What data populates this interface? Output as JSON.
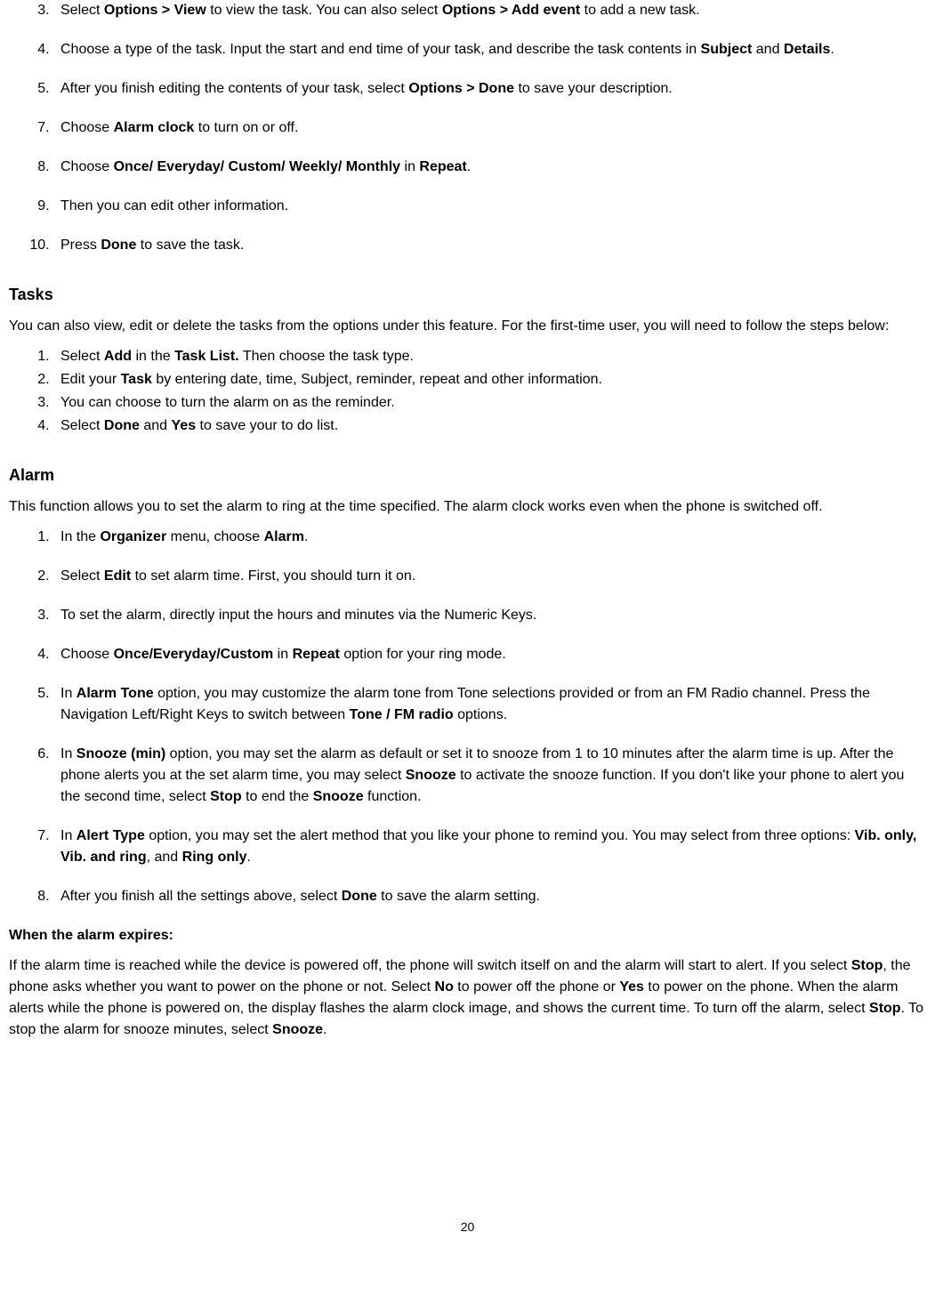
{
  "top_list": {
    "start": 3,
    "items": [
      "Select |Options > View| to view the task. You can also select |Options > Add event| to add a new task.",
      "Choose a type of the task. Input the start and end time of your task, and describe the task contents in |Subject| and |Details|.",
      "After you finish editing the contents of your task, select |Options > Done| to save your description.",
      "Choose |Alarm clock| to turn on or off.",
      "Choose |Once/ Everyday/ Custom/ Weekly/ Monthly| in |Repeat|.",
      "Then you can edit other information.",
      "Press |Done| to save the task."
    ],
    "custom_numbers": [
      3,
      4,
      5,
      7,
      8,
      9,
      10
    ]
  },
  "tasks": {
    "heading": "Tasks",
    "intro": "You can also view, edit or delete the tasks from the options under this feature. For the first-time user, you will need to follow the steps below:",
    "items": [
      "Select |Add| in the |Task List.| Then choose the task type.",
      "Edit your |Task| by entering date, time, Subject, reminder, repeat and other information.",
      "You can choose to turn the alarm on as the reminder.",
      "Select |Done| and |Yes| to save your to do list."
    ]
  },
  "alarm": {
    "heading": "Alarm",
    "intro": "This function allows you to set the alarm to ring at the time specified. The alarm clock works even when the phone is switched off.",
    "items": [
      "In the |Organizer| menu, choose |Alarm|.",
      "Select |Edit| to set alarm time. First, you should turn it on.",
      "To set the alarm, directly input the hours and minutes via the Numeric Keys.",
      "Choose |Once/Everyday/Custom| in |Repeat| option for your ring mode.",
      "In |Alarm Tone| option, you may customize the alarm tone from Tone selections provided or from an FM Radio channel. Press the Navigation Left/Right Keys to switch between |Tone / FM radio| options.",
      "In |Snooze (min)| option, you may set the alarm as default or set it to snooze from 1 to 10 minutes after the alarm time is up. After the phone alerts you at the set alarm time, you may select |Snooze| to activate the snooze function. If you don't like your phone to alert you the second time, select |Stop| to end the |Snooze| function.",
      "In |Alert Type| option, you may set the alert method that you like your phone to remind you. You may select from three options: |Vib. only, Vib. and ring|, and |Ring only|.",
      "After you finish all the settings above, select |Done| to save the alarm setting."
    ],
    "expires_heading": "When the alarm expires:",
    "expires_text": "If the alarm time is reached while the device is powered off, the phone will switch itself on and the alarm will start to alert. If you select |Stop|, the phone asks whether you want to power on the phone or not. Select |No| to power off the phone or |Yes| to power on the phone. When the alarm alerts while the phone is powered on, the display flashes the alarm clock image, and shows the current time. To turn off the alarm, select |Stop|. To stop the alarm for snooze minutes, select |Snooze|."
  },
  "page_number": "20"
}
